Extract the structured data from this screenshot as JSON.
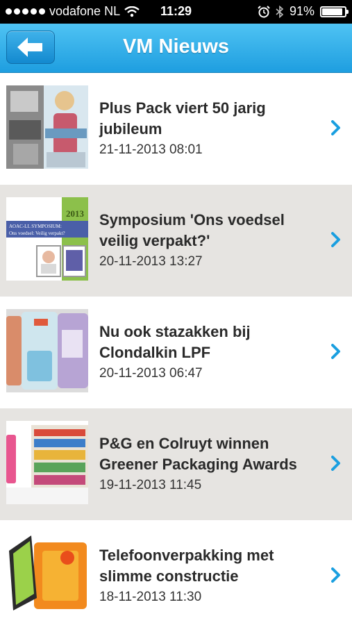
{
  "status_bar": {
    "carrier": "vodafone NL",
    "time": "11:29",
    "battery": "91%",
    "battery_level": 0.91,
    "icons": [
      "signal-dots-icon",
      "wifi-icon",
      "alarm-icon",
      "bluetooth-icon",
      "battery-icon"
    ]
  },
  "nav": {
    "title": "VM Nieuws",
    "back_icon": "back-arrow-icon"
  },
  "colors": {
    "nav_top": "#4fc3f3",
    "nav_bottom": "#1e9ee0",
    "chevron": "#1a9fe0",
    "row_alt": "#e6e4e1"
  },
  "articles": [
    {
      "title": "Plus Pack viert 50 jarig jubileum",
      "date": "21-11-2013 08:01"
    },
    {
      "title": "Symposium 'Ons voedsel veilig verpakt?'",
      "date": "20-11-2013 13:27"
    },
    {
      "title": "Nu ook stazakken bij Clondalkin LPF",
      "date": "20-11-2013 06:47"
    },
    {
      "title": "P&G en Colruyt winnen Greener Packaging Awards",
      "date": "19-11-2013 11:45"
    },
    {
      "title": "Telefoonverpakking met slimme constructie",
      "date": "18-11-2013 11:30"
    }
  ],
  "thumb_texts": {
    "symposium_badge": "2013",
    "symposium_caption_1": "AOAC-LL SYMPOSIUM:",
    "symposium_caption_2": "Ons voedsel: Veilig verpakt?"
  }
}
